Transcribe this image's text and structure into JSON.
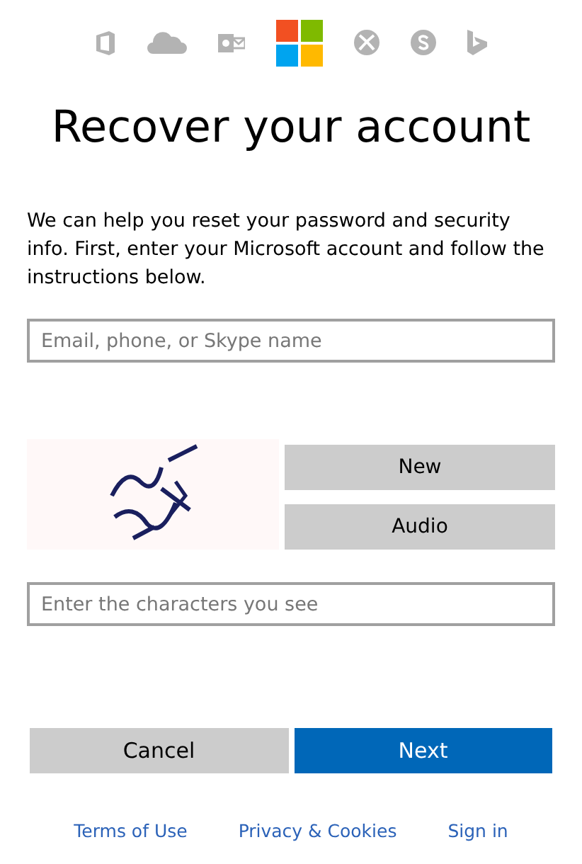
{
  "title": "Recover your account",
  "intro": "We can help you reset your password and security info. First, enter your Microsoft account and follow the instructions below.",
  "account_field": {
    "placeholder": "Email, phone, or Skype name"
  },
  "captcha": {
    "image": {
      "kind": "picture"
    },
    "buttons": [
      "New",
      "Audio"
    ],
    "field": {
      "placeholder": "Enter the characters you see"
    }
  },
  "actions": [
    {
      "label": "Cancel",
      "kind": "secondary"
    },
    {
      "label": "Next",
      "kind": "primary"
    }
  ],
  "footer_links": [
    "Terms of Use",
    "Privacy & Cookies",
    "Sign in"
  ]
}
